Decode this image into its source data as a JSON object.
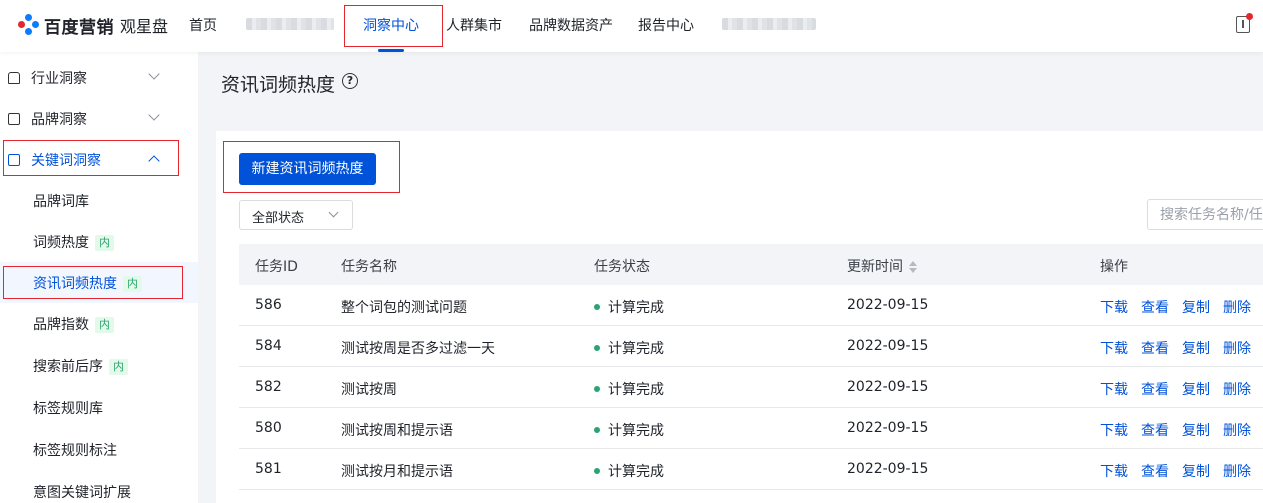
{
  "header": {
    "logo_brand": "百度营销",
    "logo_product": "观星盘",
    "nav": [
      {
        "label": "首页"
      },
      {
        "label": "洞察中心"
      },
      {
        "label": "人群集市"
      },
      {
        "label": "品牌数据资产"
      },
      {
        "label": "报告中心"
      }
    ],
    "active_nav": "洞察中心",
    "accent_color": "#0052d9"
  },
  "sidebar": {
    "groups": [
      {
        "label": "行业洞察",
        "icon": "store-icon"
      },
      {
        "label": "品牌洞察",
        "icon": "id-card-icon"
      },
      {
        "label": "关键词洞察",
        "icon": "book-icon"
      }
    ],
    "sub_items": [
      {
        "label": "品牌词库",
        "tag": ""
      },
      {
        "label": "词频热度",
        "tag": "内"
      },
      {
        "label": "资讯词频热度",
        "tag": "内"
      },
      {
        "label": "品牌指数",
        "tag": "内"
      },
      {
        "label": "搜索前后序",
        "tag": "内"
      },
      {
        "label": "标签规则库",
        "tag": ""
      },
      {
        "label": "标签规则标注",
        "tag": ""
      },
      {
        "label": "意图关键词扩展",
        "tag": ""
      }
    ],
    "selected_item": "资讯词频热度"
  },
  "main": {
    "title": "资讯词频热度",
    "create_button": "新建资讯词频热度",
    "status_filter": "全部状态",
    "search_placeholder": "搜索任务名称/任务ID"
  },
  "table": {
    "columns": [
      "任务ID",
      "任务名称",
      "任务状态",
      "更新时间",
      "操作"
    ],
    "rows": [
      {
        "id": "586",
        "name": "整个词包的测试问题",
        "status": "计算完成",
        "updated": "2022-09-15"
      },
      {
        "id": "584",
        "name": "测试按周是否多过滤一天",
        "status": "计算完成",
        "updated": "2022-09-15"
      },
      {
        "id": "582",
        "name": "测试按周",
        "status": "计算完成",
        "updated": "2022-09-15"
      },
      {
        "id": "580",
        "name": "测试按周和提示语",
        "status": "计算完成",
        "updated": "2022-09-15"
      },
      {
        "id": "581",
        "name": "测试按月和提示语",
        "status": "计算完成",
        "updated": "2022-09-15"
      }
    ],
    "actions": [
      "下载",
      "查看",
      "复制",
      "删除"
    ],
    "status_color": "#2ba471"
  }
}
